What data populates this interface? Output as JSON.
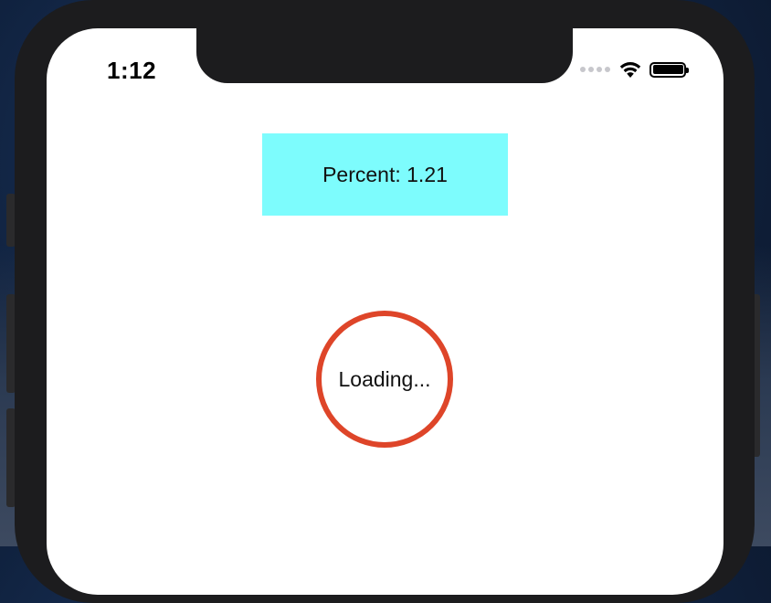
{
  "colors": {
    "percent_box_bg": "#7dfcfd",
    "loader_ring": "#de4529",
    "screen_bg": "#ffffff",
    "phone_frame": "#1c1c1e"
  },
  "status_bar": {
    "time": "1:12",
    "icons": [
      "signal-dots-icon",
      "wifi-icon",
      "battery-icon"
    ],
    "battery_level": 1.0
  },
  "main": {
    "percent_text": "Percent: 1.21",
    "loading_text": "Loading..."
  }
}
